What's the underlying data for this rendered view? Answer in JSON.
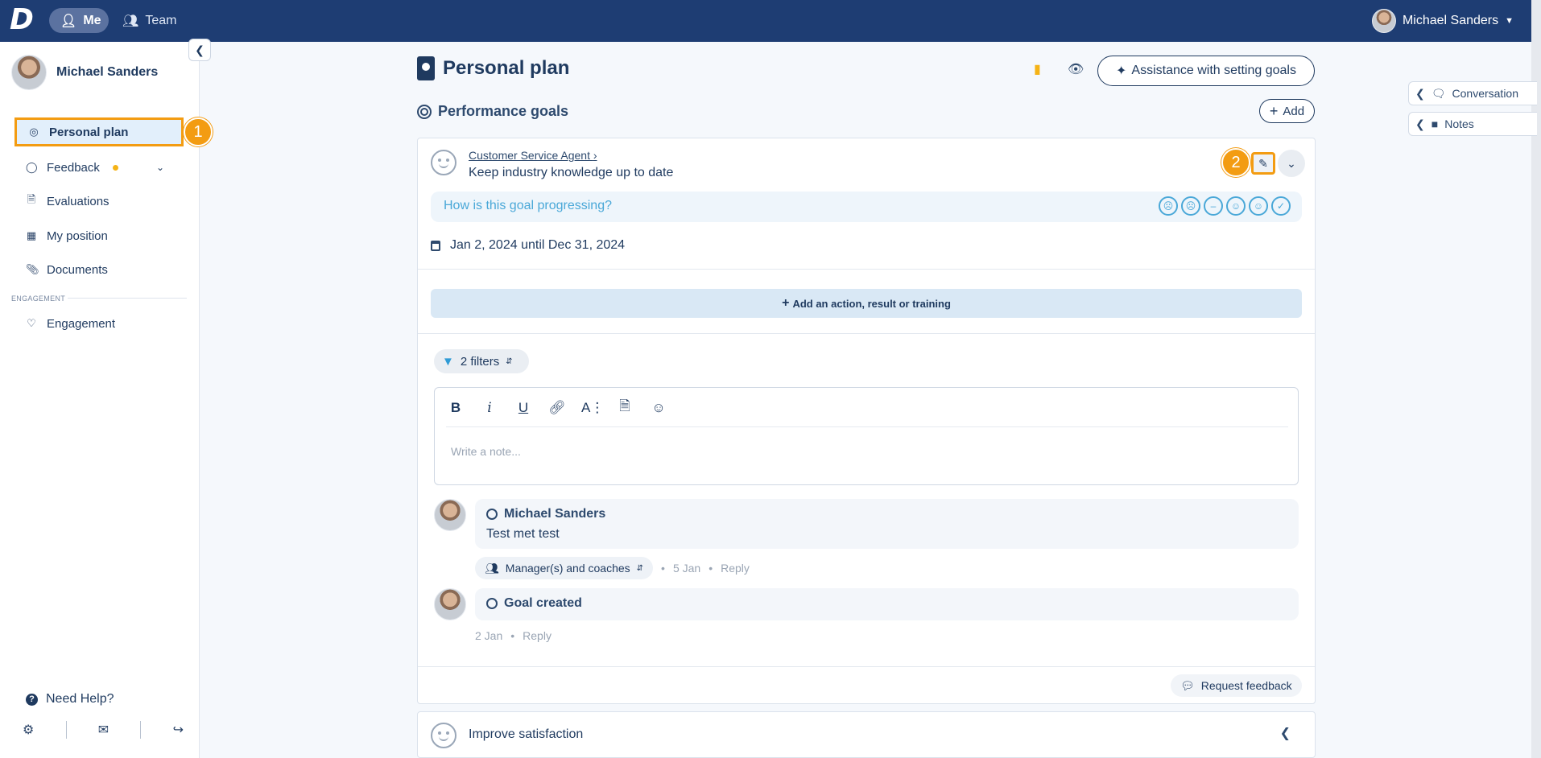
{
  "topbar": {
    "logo": "D",
    "nav": [
      {
        "label": "Me"
      },
      {
        "label": "Team"
      }
    ],
    "user_name": "Michael Sanders"
  },
  "sidebar": {
    "user_name": "Michael Sanders",
    "items": [
      {
        "label": "Personal plan",
        "icon": "target-icon",
        "active": true
      },
      {
        "label": "Feedback",
        "icon": "comment-icon",
        "has_dot": true
      },
      {
        "label": "Evaluations",
        "icon": "document-icon"
      },
      {
        "label": "My position",
        "icon": "id-card-icon"
      },
      {
        "label": "Documents",
        "icon": "paperclip-icon"
      }
    ],
    "section_label": "ENGAGEMENT",
    "engagement_item": {
      "label": "Engagement",
      "icon": "heart-pulse-icon"
    },
    "help_label": "Need Help?"
  },
  "callouts": [
    "1",
    "2"
  ],
  "page": {
    "title": "Personal plan",
    "assist_label": "Assistance with setting goals",
    "section_title": "Performance goals",
    "add_label": "Add"
  },
  "side_tabs": [
    "Conversation",
    "Notes"
  ],
  "goal": {
    "role": "Customer Service Agent",
    "name": "Keep industry knowledge up to date",
    "progress_question": "How is this goal progressing?",
    "date_range": "Jan 2, 2024 until Dec 31, 2024",
    "add_action_label": "Add an action, result or training",
    "filters_label": "2 filters",
    "editor_placeholder": "Write a note...",
    "notes": [
      {
        "author": "Michael Sanders",
        "text": "Test met test",
        "visibility": "Manager(s) and coaches",
        "date": "5 Jan",
        "reply": "Reply"
      },
      {
        "author": "Goal created",
        "text": "",
        "date": "2 Jan",
        "reply": "Reply"
      }
    ],
    "request_feedback_label": "Request feedback"
  },
  "goal2": {
    "name": "Improve satisfaction"
  },
  "colors": {
    "accent": "#f39c12",
    "primary": "#1e3d73",
    "light_blue": "#4aa8d8"
  }
}
